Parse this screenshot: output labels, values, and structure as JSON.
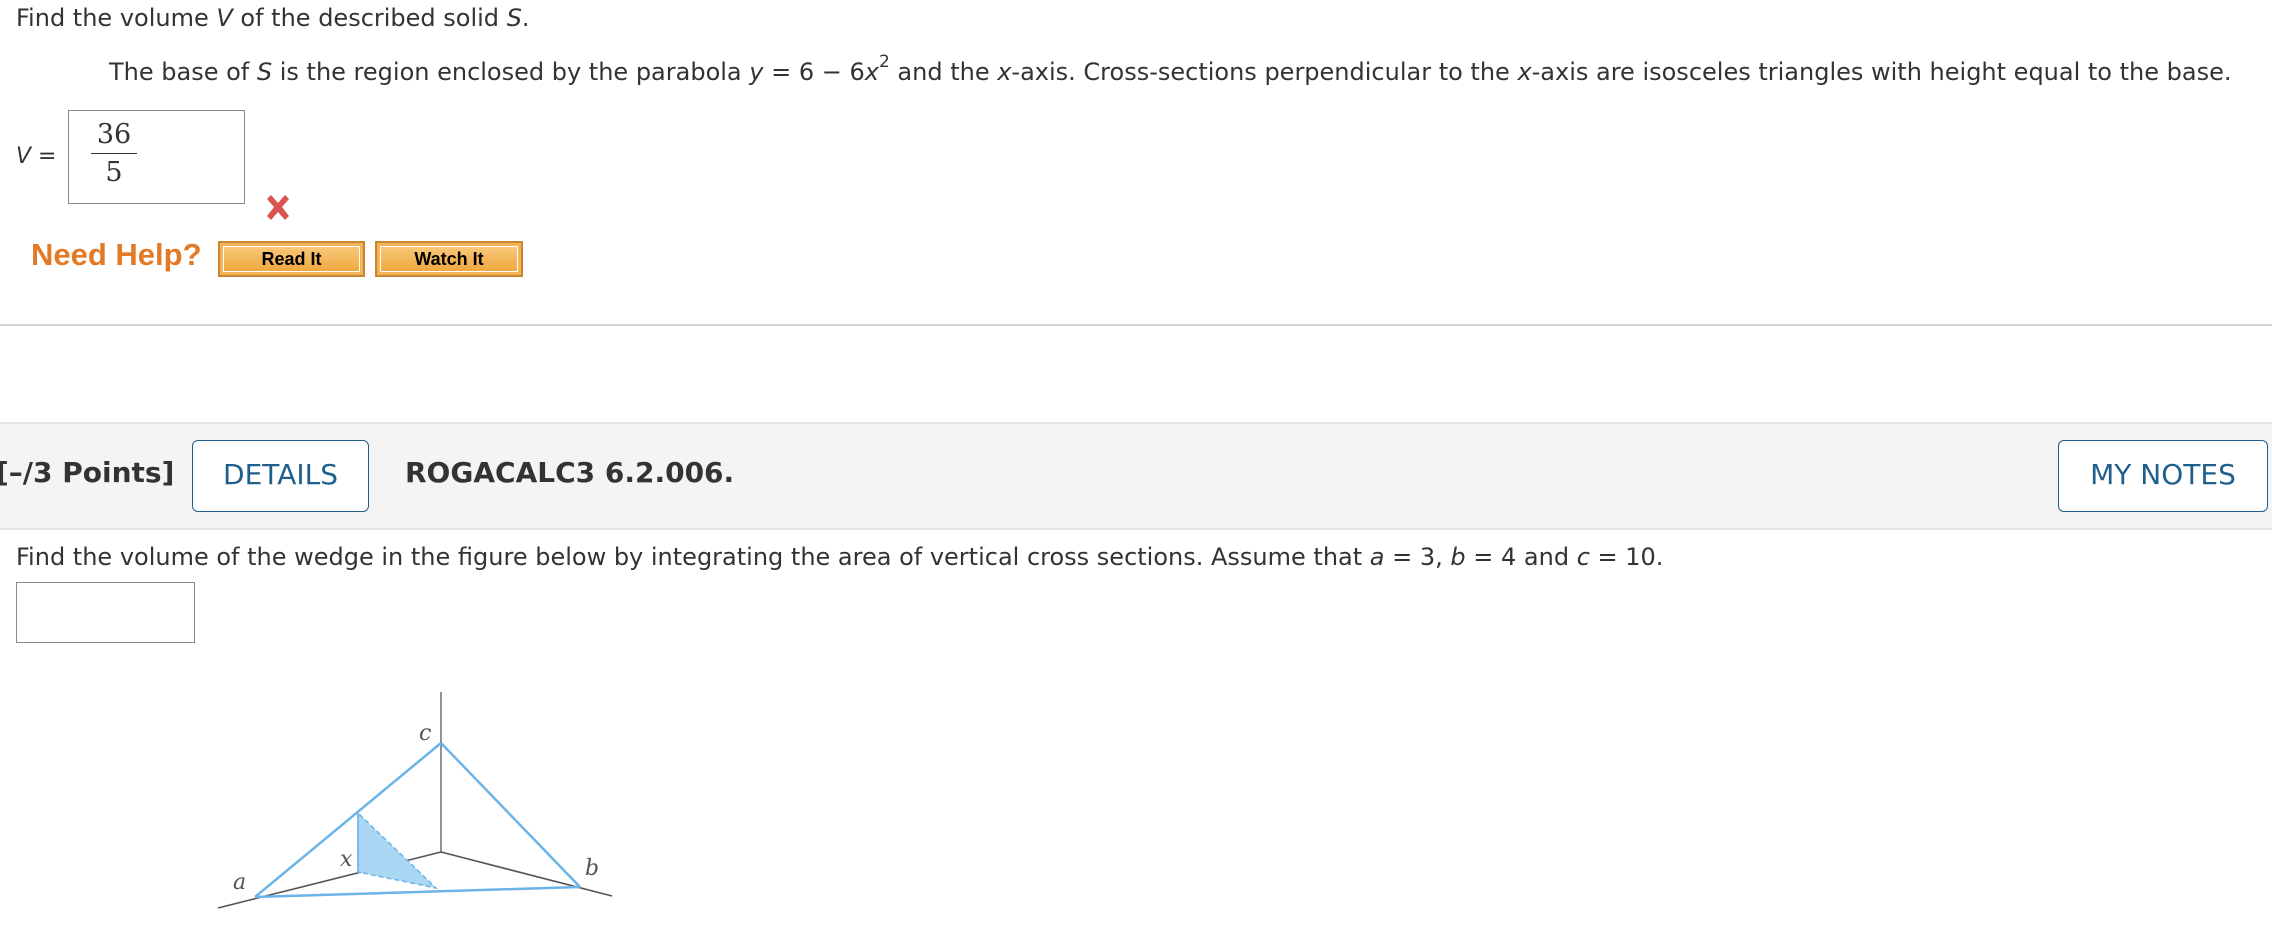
{
  "question1": {
    "prompt": {
      "text1": "Find the volume ",
      "var_v": "V",
      "text2": " of the described solid ",
      "var_s": "S",
      "text3": "."
    },
    "description": {
      "t1": "The base of ",
      "s": "S",
      "t2": " is the region enclosed by the parabola ",
      "y": "y",
      "t3": " = 6 − 6",
      "x1": "x",
      "exp": "2",
      "t4": " and the ",
      "x2": "x",
      "t5": "-axis. Cross-sections perpendicular to the ",
      "x3": "x",
      "t6": "-axis are isosceles triangles with height equal to the base."
    },
    "answer_label": {
      "var": "V",
      "eq": " ="
    },
    "answer": {
      "numerator": "36",
      "denominator": "5"
    },
    "status_icon": "wrong-x-icon",
    "help": {
      "label": "Need Help?",
      "read_it": "Read It",
      "watch_it": "Watch It"
    }
  },
  "question2": {
    "points": "[–/3 Points]",
    "details_button": "DETAILS",
    "question_id": "ROGACALC3 6.2.006.",
    "my_notes_button": "MY NOTES",
    "prompt": {
      "t1": "Find the volume of the wedge in the figure below by integrating the area of vertical cross sections. Assume that  ",
      "a": "a",
      "t2": " = 3, ",
      "b": "b",
      "t3": " = 4  and  ",
      "c": "c",
      "t4": " = 10."
    },
    "answer_value": "",
    "figure": {
      "label_a": "a",
      "label_b": "b",
      "label_c": "c",
      "label_x": "x"
    }
  },
  "colors": {
    "help_orange": "#e27a26",
    "button_fill": "#f4b357",
    "link_blue": "#1f5f8b",
    "wrong_red": "#d9534f",
    "edge_blue": "#6cb4e8",
    "section_fill": "#a9d6f2"
  }
}
